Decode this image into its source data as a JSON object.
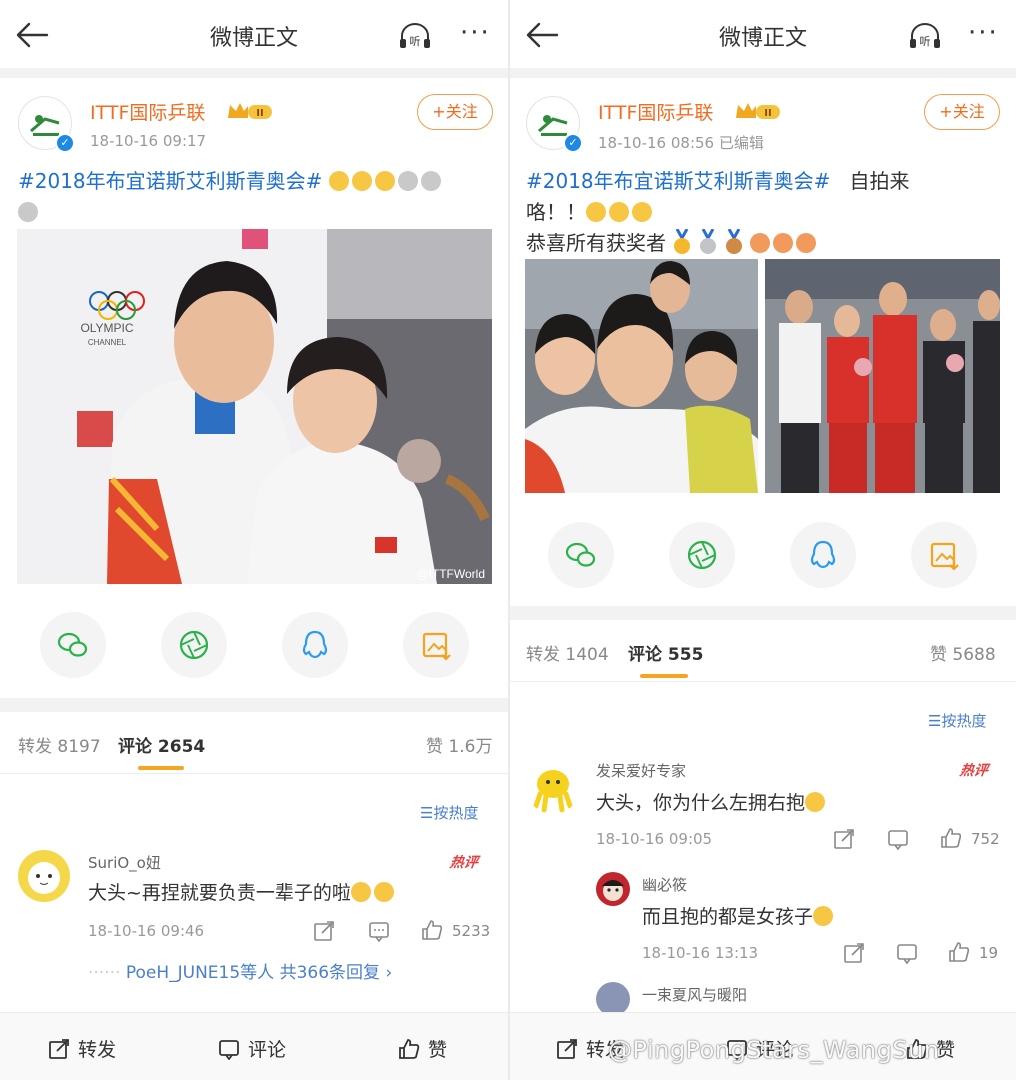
{
  "left": {
    "nav": {
      "title": "微博正文",
      "listen_label": "听"
    },
    "post": {
      "username": "ITTF国际乒联",
      "level_badge": "II",
      "time": "18-10-16 09:17",
      "follow_label": "+关注",
      "topic": "#2018年布宜诺斯艾利斯青奥会#",
      "photo_watermark": "@ITTFWorld",
      "photo_sign_text": "OLYMPIC",
      "photo_sign_sub": "CHANNEL"
    },
    "tabs": {
      "repost_label": "转发",
      "repost_count": "8197",
      "comment_label": "评论",
      "comment_count": "2654",
      "like_label": "赞",
      "like_count": "1.6万"
    },
    "sort_label": "按热度",
    "comment": {
      "name": "SuriO_o妞",
      "text": "大头~再捏就要负责一辈子的啦",
      "time": "18-10-16 09:46",
      "likes": "5233",
      "hot_tag": "热评",
      "replies_prefix": "PoeH_JUNE15等人",
      "replies_count": "共366条回复"
    },
    "bottom": {
      "repost": "转发",
      "comment": "评论",
      "like": "赞"
    }
  },
  "right": {
    "nav": {
      "title": "微博正文",
      "listen_label": "听"
    },
    "post": {
      "username": "ITTF国际乒联",
      "level_badge": "II",
      "time": "18-10-16 08:56",
      "edited": "已编辑",
      "follow_label": "+关注",
      "topic": "#2018年布宜诺斯艾利斯青奥会#",
      "text_tail": "自拍来",
      "text_line2": "咯！！",
      "text_line3": "恭喜所有获奖者"
    },
    "tabs": {
      "repost_label": "转发",
      "repost_count": "1404",
      "comment_label": "评论",
      "comment_count": "555",
      "like_label": "赞",
      "like_count": "5688"
    },
    "sort_label": "按热度",
    "comments": [
      {
        "name": "发呆爱好专家",
        "text": "大头，你为什么左拥右抱",
        "time": "18-10-16 09:05",
        "likes": "752",
        "hot_tag": "热评"
      },
      {
        "name": "幽必筱",
        "text": "而且抱的都是女孩子",
        "time": "18-10-16 13:13",
        "likes": "19"
      },
      {
        "name": "一束夏风与暖阳"
      }
    ],
    "bottom": {
      "repost": "转发",
      "comment": "评论",
      "like": "赞"
    }
  },
  "watermark": "@PingPongStars_WangSun",
  "colors": {
    "accent_orange": "#f36b1d",
    "link_blue": "#1e6fd0",
    "tab_underline": "#f6a523",
    "hot_red": "#e84040"
  }
}
